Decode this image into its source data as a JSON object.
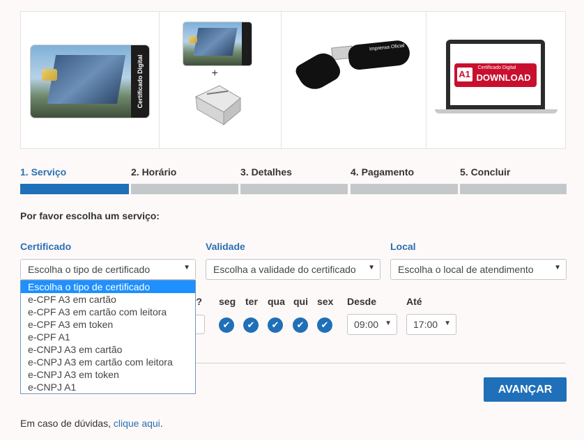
{
  "products": {
    "card_label": "Certificado Digital",
    "plus": "+",
    "token_logo": "Imprensa Oficial",
    "download_sub": "Certificado Digital",
    "download_a1": "A1",
    "download_label": "DOWNLOAD"
  },
  "steps": [
    {
      "label": "1. Serviço",
      "active": true
    },
    {
      "label": "2. Horário",
      "active": false
    },
    {
      "label": "3. Detalhes",
      "active": false
    },
    {
      "label": "4. Pagamento",
      "active": false
    },
    {
      "label": "5. Concluir",
      "active": false
    }
  ],
  "prompt": "Por favor escolha um serviço:",
  "fields": {
    "certificado": {
      "label": "Certificado",
      "value": "Escolha o tipo de certificado"
    },
    "validade": {
      "label": "Validade",
      "value": "Escolha a validade do certificado"
    },
    "local": {
      "label": "Local",
      "value": "Escolha o local de atendimento"
    }
  },
  "dropdown_options": [
    "Escolha o tipo de certificado",
    "e-CPF A3 em cartão",
    "e-CPF A3 em cartão com leitora",
    "e-CPF A3 em token",
    "e-CPF A1",
    "e-CNPJ A3 em cartão",
    "e-CNPJ A3 em cartão com leitora",
    "e-CNPJ A3 em token",
    "e-CNPJ A1"
  ],
  "schedule": {
    "partial_question": "r?",
    "days": [
      "seg",
      "ter",
      "qua",
      "qui",
      "sex"
    ],
    "from_label": "Desde",
    "from_value": "09:00",
    "to_label": "Até",
    "to_value": "17:00"
  },
  "next_button": "AVANÇAR",
  "help_text": "Em caso de dúvidas, ",
  "help_link": "clique aqui",
  "help_end": "."
}
